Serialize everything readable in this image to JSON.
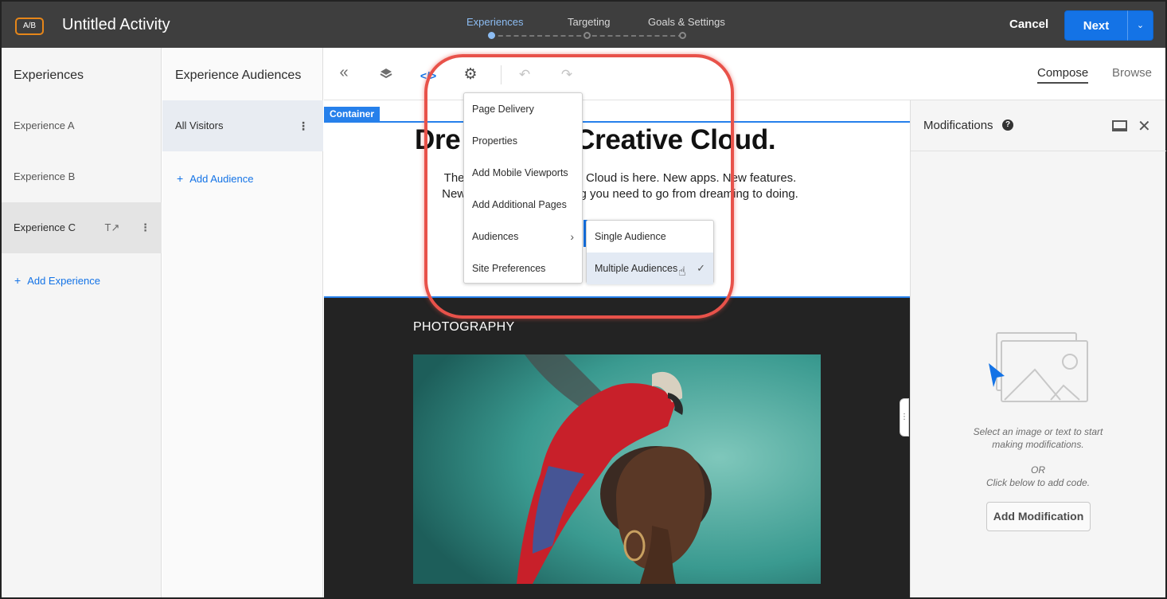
{
  "header": {
    "badge": "A/B",
    "activity_title": "Untitled Activity",
    "steps": [
      {
        "label": "Experiences",
        "active": true
      },
      {
        "label": "Targeting",
        "active": false
      },
      {
        "label": "Goals & Settings",
        "active": false
      }
    ],
    "cancel_label": "Cancel",
    "next_label": "Next"
  },
  "experiences": {
    "title": "Experiences",
    "items": [
      {
        "label": "Experience A",
        "selected": false
      },
      {
        "label": "Experience B",
        "selected": false
      },
      {
        "label": "Experience C",
        "selected": true
      }
    ],
    "add_label": "Add Experience"
  },
  "audiences": {
    "title": "Experience Audiences",
    "items": [
      {
        "label": "All Visitors"
      }
    ],
    "add_label": "Add Audience"
  },
  "toolbar": {
    "compose_label": "Compose",
    "browse_label": "Browse",
    "code_icon": "</>"
  },
  "canvas": {
    "container_tag": "Container",
    "hero_title": "Dre          er. Creative Cloud.",
    "hero_line1": "The n                            ive Cloud is here. New apps. New features.",
    "hero_line2": "New wa                        hing you need to go from dreaming to doing.",
    "section_label": "PHOTOGRAPHY"
  },
  "settings_menu": {
    "items": [
      {
        "label": "Page Delivery",
        "has_submenu": false
      },
      {
        "label": "Properties",
        "has_submenu": false
      },
      {
        "label": "Add Mobile Viewports",
        "has_submenu": false
      },
      {
        "label": "Add Additional Pages",
        "has_submenu": false
      },
      {
        "label": "Audiences",
        "has_submenu": true
      },
      {
        "label": "Site Preferences",
        "has_submenu": false
      }
    ],
    "submenu": [
      {
        "label": "Single Audience",
        "checked": false
      },
      {
        "label": "Multiple Audiences",
        "checked": true
      }
    ]
  },
  "modifications": {
    "title": "Modifications",
    "hint_line1": "Select an image or text to start",
    "hint_line2": "making modifications.",
    "or_label": "OR",
    "hint_line3": "Click below to add code.",
    "add_button": "Add Modification"
  },
  "colors": {
    "accent": "#1473e6",
    "topbar": "#3e3e3e",
    "highlight": "#e8524a",
    "badge_border": "#e68619"
  }
}
